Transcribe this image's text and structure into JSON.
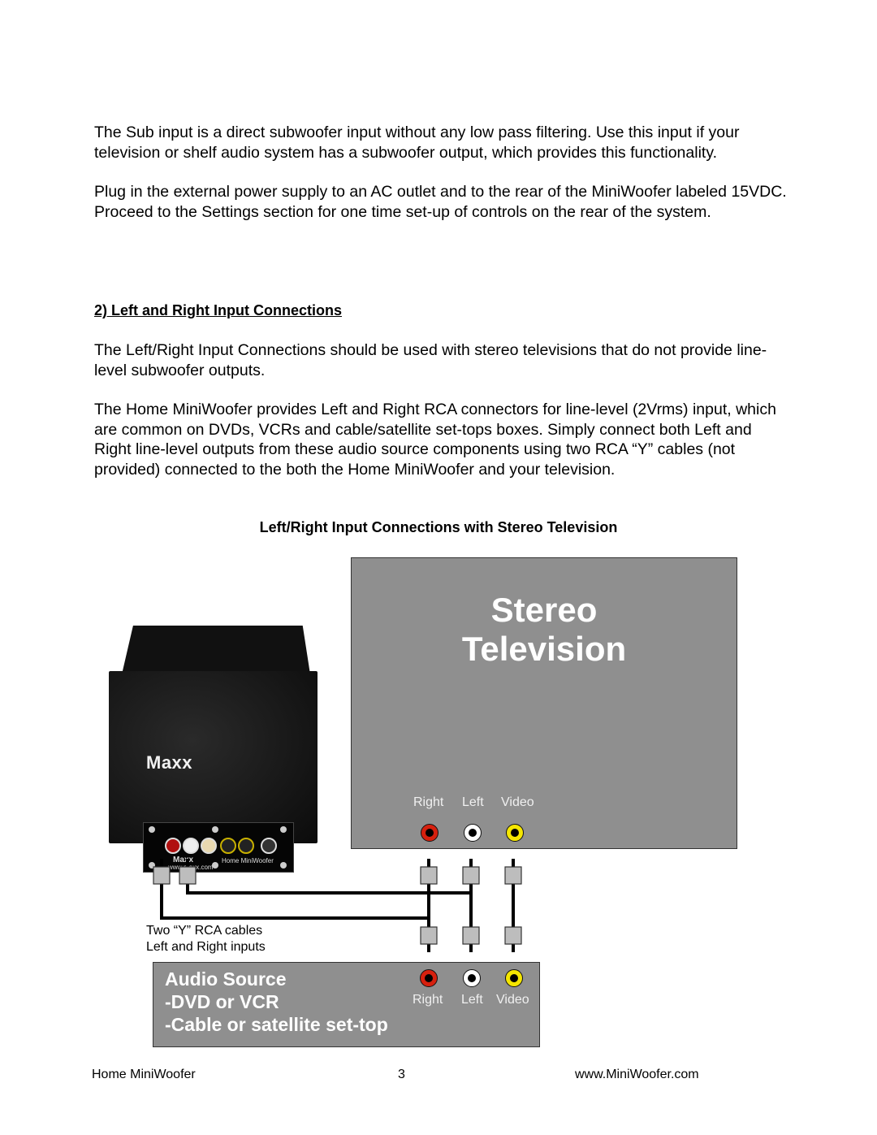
{
  "paragraphs_top": [
    "The Sub input is a direct subwoofer input without any low pass filtering.  Use this input if your television or shelf audio system has a subwoofer output, which provides this functionality.",
    "Plug in the external power supply to an AC outlet and to the rear of the MiniWoofer labeled 15VDC.  Proceed to the Settings section for one time set-up of controls on the rear of the system."
  ],
  "section_heading": "2)  Left and Right Input Connections",
  "paragraphs_section": [
    "The Left/Right Input Connections should be used with stereo televisions that do not provide line-level subwoofer outputs.",
    "The Home MiniWoofer provides Left and Right RCA connectors for line-level (2Vrms) input, which are common on DVDs, VCRs and cable/satellite set-tops boxes.  Simply connect both Left and Right line-level outputs from these audio source components using two RCA “Y” cables (not provided) connected to the both the Home MiniWoofer and your television."
  ],
  "diagram": {
    "title": "Left/Right Input Connections with Stereo Television",
    "television": {
      "title_line1": "Stereo",
      "title_line2": "Television",
      "jacks": [
        {
          "label": "Right",
          "color": "#d6200e"
        },
        {
          "label": "Left",
          "color": "#ffffff"
        },
        {
          "label": "Video",
          "color": "#f5e600"
        }
      ]
    },
    "subwoofer": {
      "brand": "Maxx",
      "panel_brand": "Maxx",
      "panel_url": "www.maxx.com",
      "panel_model": "Home MiniWoofer"
    },
    "cable_caption": [
      "Two “Y” RCA cables",
      "Left and Right inputs"
    ],
    "audio_source": {
      "lines": [
        "Audio Source",
        "-DVD or VCR",
        "-Cable or satellite set-top"
      ],
      "jacks": [
        {
          "label": "Right",
          "color": "#d6200e"
        },
        {
          "label": "Left",
          "color": "#ffffff"
        },
        {
          "label": "Video",
          "color": "#f5e600"
        }
      ]
    }
  },
  "footer": {
    "left": "Home MiniWoofer",
    "page_number": "3",
    "right": "www.MiniWoofer.com"
  }
}
